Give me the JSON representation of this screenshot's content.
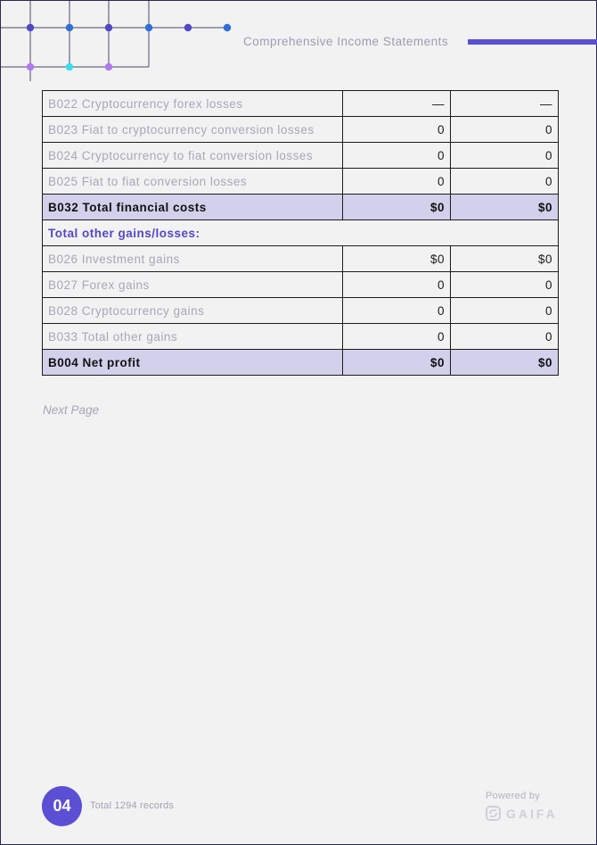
{
  "header": {
    "title": "Comprehensive Income Statements",
    "accent_color": "#5b4fd4"
  },
  "table": {
    "rows": [
      {
        "kind": "item",
        "label": "B022 Cryptocurrency forex losses",
        "v1": "—",
        "v2": "—"
      },
      {
        "kind": "item",
        "label": "B023 Fiat to cryptocurrency conversion losses",
        "v1": "0",
        "v2": "0"
      },
      {
        "kind": "item",
        "label": "B024 Cryptocurrency to fiat conversion losses",
        "v1": "0",
        "v2": "0"
      },
      {
        "kind": "item",
        "label": "B025 Fiat to fiat conversion losses",
        "v1": "0",
        "v2": "0"
      },
      {
        "kind": "total",
        "label": "B032 Total financial costs",
        "v1": "$0",
        "v2": "$0"
      },
      {
        "kind": "section",
        "label": "Total other gains/losses:"
      },
      {
        "kind": "item",
        "label": "B026 Investment gains",
        "v1": "$0",
        "v2": "$0"
      },
      {
        "kind": "item",
        "label": "B027 Forex gains",
        "v1": "0",
        "v2": "0"
      },
      {
        "kind": "item",
        "label": "B028 Cryptocurrency gains",
        "v1": "0",
        "v2": "0"
      },
      {
        "kind": "item",
        "label": "B033 Total other gains",
        "v1": "0",
        "v2": "0"
      },
      {
        "kind": "total",
        "label": "B004 Net profit",
        "v1": "$0",
        "v2": "$0"
      }
    ]
  },
  "next_page": "Next Page",
  "footer": {
    "page_number": "04",
    "records": "Total 1294 records",
    "powered_by": "Powered by",
    "brand": "GAIFA",
    "brand_icon": "gaifa-logo-icon"
  }
}
